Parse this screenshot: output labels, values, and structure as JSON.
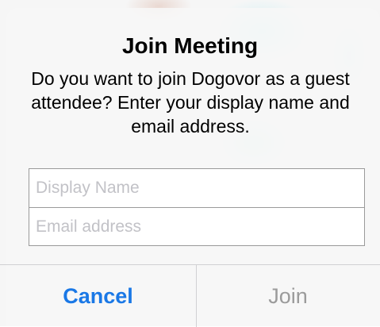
{
  "dialog": {
    "title": "Join Meeting",
    "message": "Do you want to join Dogovor as a guest attendee? Enter your display name and email address."
  },
  "fields": {
    "display_name": {
      "value": "",
      "placeholder": "Display Name"
    },
    "email": {
      "value": "",
      "placeholder": "Email address"
    }
  },
  "actions": {
    "cancel_label": "Cancel",
    "join_label": "Join",
    "join_enabled": false
  },
  "colors": {
    "accent": "#1a78e6",
    "disabled": "#9b9b9b"
  }
}
